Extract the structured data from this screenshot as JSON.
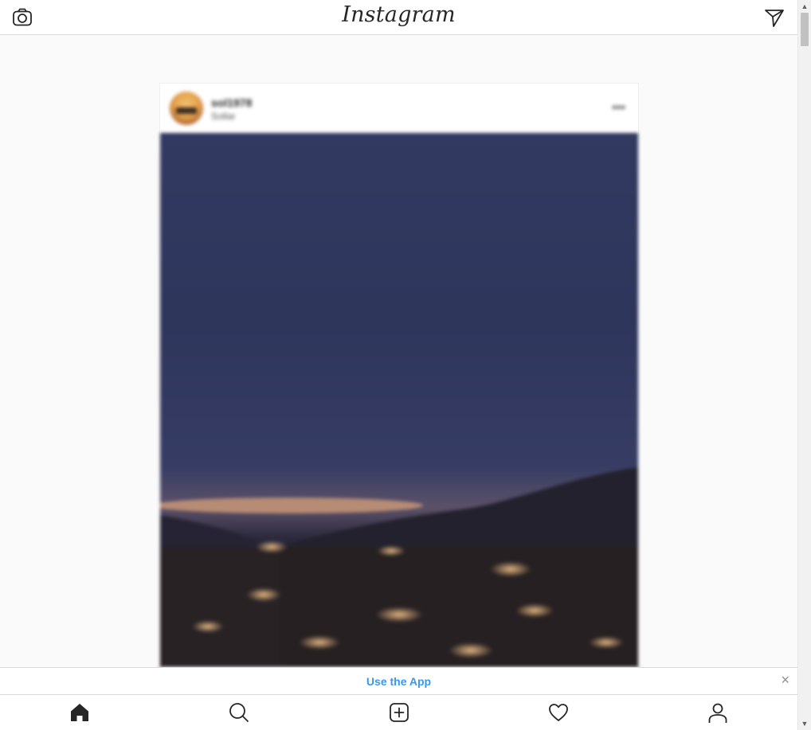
{
  "header": {
    "brand": "Instagram",
    "left_icon": "camera-icon",
    "right_icon": "direct-send-icon"
  },
  "post": {
    "username": "sol1978",
    "location": "Sollar",
    "more_icon": "more-options-icon",
    "more_label": "•••"
  },
  "banner": {
    "link_text": "Use the App",
    "close_label": "×"
  },
  "bottom_nav": {
    "items": [
      "home-icon",
      "search-icon",
      "new-post-icon",
      "activity-heart-icon",
      "profile-icon"
    ]
  },
  "colors": {
    "accent": "#3897f0",
    "text": "#262626",
    "border": "#dbdbdb",
    "background": "#fafafa"
  }
}
